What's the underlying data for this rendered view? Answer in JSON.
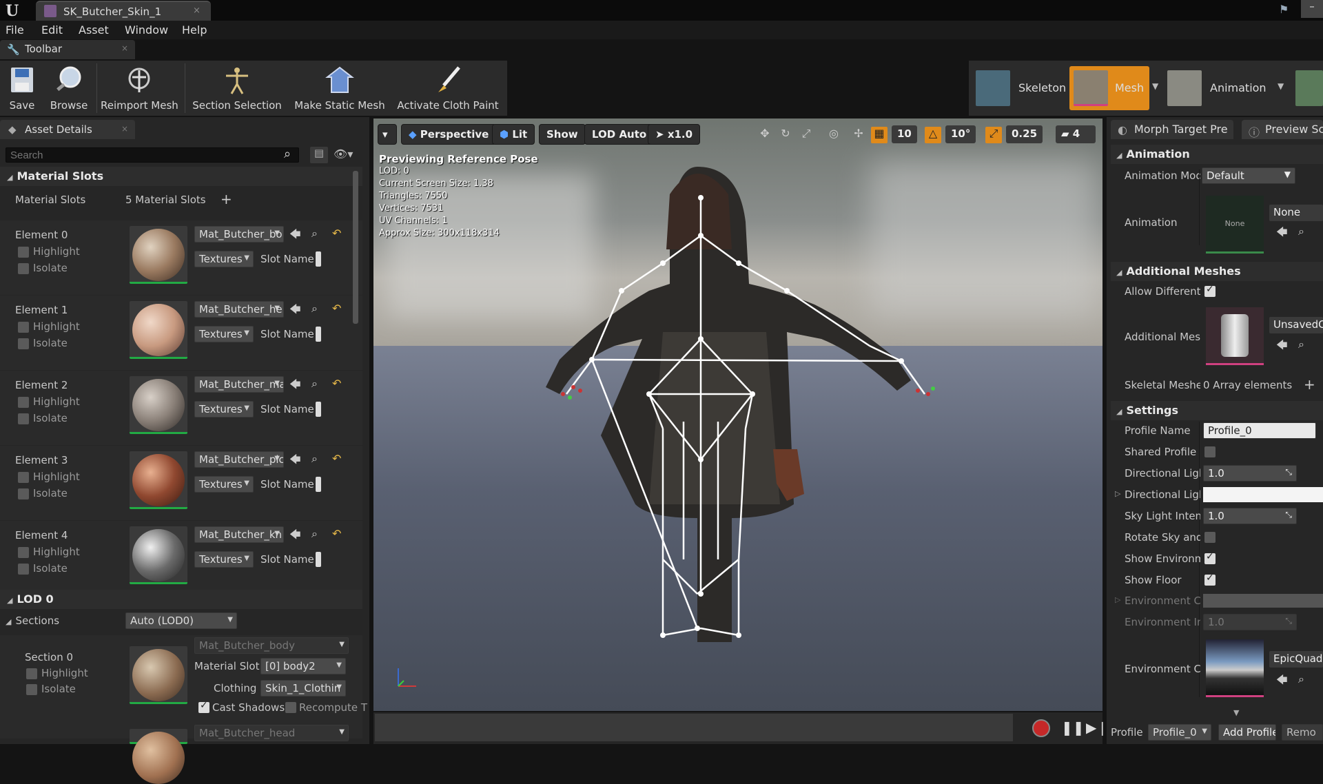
{
  "window": {
    "title": "SK_Butcher_Skin_1",
    "close": "×"
  },
  "menu": [
    "File",
    "Edit",
    "Asset",
    "Window",
    "Help"
  ],
  "toolbar_tab": {
    "label": "Toolbar"
  },
  "toolbar": {
    "save": "Save",
    "browse": "Browse",
    "reimport": "Reimport Mesh",
    "section_selection": "Section Selection",
    "make_static": "Make Static Mesh",
    "cloth_paint": "Activate Cloth Paint"
  },
  "modes": {
    "skeleton": "Skeleton",
    "mesh": "Mesh",
    "animation": "Animation"
  },
  "asset_details": {
    "tab": "Asset Details",
    "search_placeholder": "Search",
    "material_slots_header": "Material Slots",
    "material_slots_label": "Material Slots",
    "material_slots_count": "5 Material Slots",
    "highlight": "Highlight",
    "isolate": "Isolate",
    "textures": "Textures",
    "slot_name": "Slot Name",
    "elements": [
      {
        "name": "Element 0",
        "material": "Mat_Butcher_bo"
      },
      {
        "name": "Element 1",
        "material": "Mat_Butcher_he"
      },
      {
        "name": "Element 2",
        "material": "Mat_Butcher_ma"
      },
      {
        "name": "Element 3",
        "material": "Mat_Butcher_pic"
      },
      {
        "name": "Element 4",
        "material": "Mat_Butcher_kn"
      }
    ],
    "lod_header": "LOD 0",
    "sections_label": "Sections",
    "sections_value": "Auto (LOD0)",
    "section0": {
      "name": "Section 0",
      "material": "Mat_Butcher_body",
      "material_slot_label": "Material Slot",
      "material_slot_value": "[0] body2",
      "clothing_label": "Clothing",
      "clothing_value": "Skin_1_Clothin",
      "cast_shadows": "Cast Shadows",
      "recompute": "Recompute T"
    },
    "section1_material": "Mat_Butcher_head"
  },
  "viewport": {
    "perspective": "Perspective",
    "lit": "Lit",
    "show": "Show",
    "lod": "LOD Auto",
    "speed": "x1.0",
    "grid": "10",
    "angle": "10°",
    "scale": "0.25",
    "camera_speed": "4",
    "info": {
      "heading": "Previewing Reference Pose",
      "lod": "LOD: 0",
      "screen_size": "Current Screen Size: 1.38",
      "triangles": "Triangles: 7550",
      "vertices": "Vertices: 7531",
      "uv_channels": "UV Channels: 1",
      "approx_size": "Approx Size: 300x118x314"
    }
  },
  "right_panel": {
    "tab_morph": "Morph Target Pre",
    "tab_preview": "Preview Sc",
    "animation_header": "Animation",
    "animation_mode_label": "Animation Mod",
    "animation_mode_value": "Default",
    "animation_label": "Animation",
    "animation_thumb": "None",
    "animation_value": "None",
    "additional_meshes_header": "Additional Meshes",
    "allow_different": "Allow Different",
    "additional_mes_label": "Additional Mes",
    "additional_mes_value": "UnsavedC",
    "skeletal_meshes_label": "Skeletal Meshe",
    "skeletal_meshes_value": "0 Array elements",
    "settings_header": "Settings",
    "profile_name_label": "Profile Name",
    "profile_name_value": "Profile_0",
    "shared_profile": "Shared Profile",
    "directional_light_label": "Directional Ligh",
    "directional_light_value": "1.0",
    "directional_light2_label": "Directional Ligl",
    "sky_light_label": "Sky Light Inten:",
    "sky_light_value": "1.0",
    "rotate_sky": "Rotate Sky and",
    "show_environment": "Show Environm",
    "show_floor": "Show Floor",
    "environment_color": "Environment C",
    "environment_intensity_label": "Environment Int",
    "environment_intensity_value": "1.0",
    "environment_cube_label": "Environment Cu",
    "environment_cube_value": "EpicQuadP",
    "profile_label": "Profile",
    "profile_value": "Profile_0",
    "add_profile": "Add Profile",
    "remove": "Remo"
  },
  "colors": {
    "accent_orange": "#e08a1a",
    "selected_green": "#22aa44",
    "record_red": "#c62828"
  }
}
